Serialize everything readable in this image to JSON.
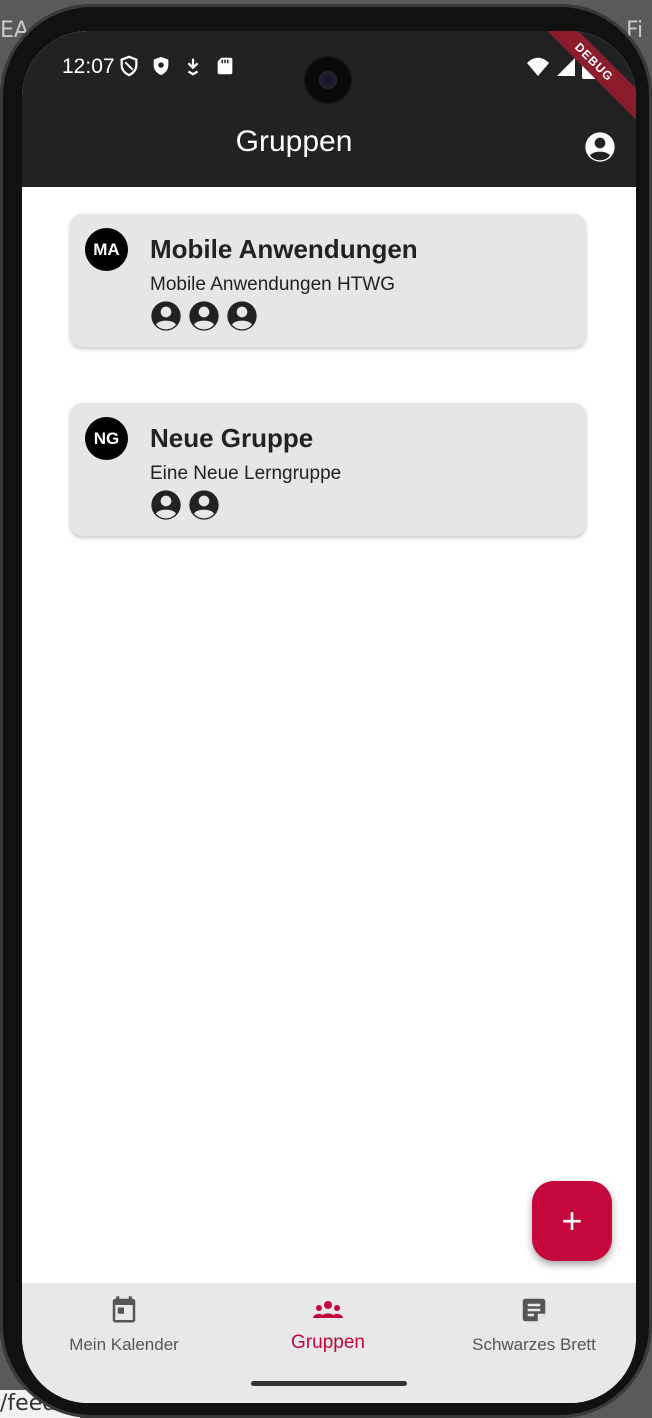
{
  "background": {
    "left_fragment": "EA",
    "right_fragment": "Fi",
    "bottom_fragment": "/feed"
  },
  "status_bar": {
    "time": "12:07",
    "left_icons": [
      "vpn-shield-icon",
      "shield-icon",
      "download-icon",
      "sd-card-icon"
    ],
    "right_icons": [
      "wifi-icon",
      "cell-signal-icon",
      "battery-icon"
    ]
  },
  "debug_banner": "DEBUG",
  "app_bar": {
    "title": "Gruppen",
    "action_icon": "account-circle-icon"
  },
  "groups": [
    {
      "initials": "MA",
      "title": "Mobile Anwendungen",
      "description": "Mobile Anwendungen HTWG",
      "member_count": 3
    },
    {
      "initials": "NG",
      "title": "Neue Gruppe",
      "description": "Eine Neue Lerngruppe",
      "member_count": 2
    }
  ],
  "fab": {
    "label": "+",
    "icon": "add-icon"
  },
  "bottom_nav": {
    "items": [
      {
        "label": "Mein Kalender",
        "icon": "calendar-icon",
        "active": false
      },
      {
        "label": "Gruppen",
        "icon": "groups-icon",
        "active": true
      },
      {
        "label": "Schwarzes Brett",
        "icon": "sticky-note-icon",
        "active": false
      }
    ]
  },
  "colors": {
    "app_bar": "#222222",
    "accent": "#c4063d",
    "card": "#e6e6e6",
    "nav_bar": "#e8e8e8"
  }
}
